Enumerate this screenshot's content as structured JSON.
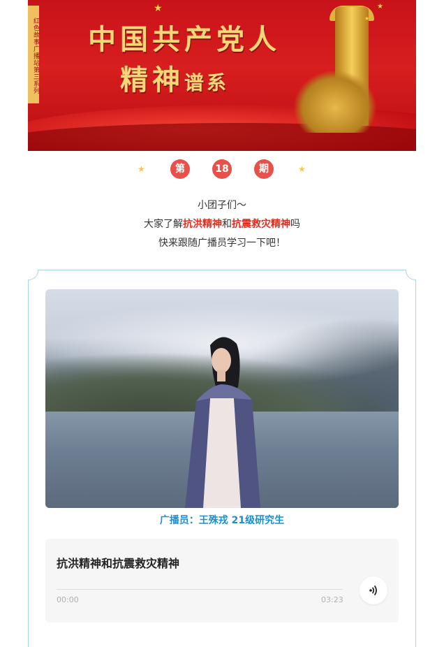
{
  "banner": {
    "side_tag": "红色故事广播站第三系列",
    "title_line1": "中国共产党人",
    "title_line2": "精神",
    "title_line2_small": "谱系"
  },
  "issue": {
    "prefix": "第",
    "number": "18",
    "suffix": "期"
  },
  "intro": {
    "line1": "小团子们～",
    "line2_a": "大家了解",
    "line2_b": "抗洪精神",
    "line2_c": "和",
    "line2_d": "抗震救灾精神",
    "line2_e": "吗",
    "line3": "快来跟随广播员学习一下吧！"
  },
  "caption": "广播员：王殊戎  21级研究生",
  "player": {
    "title": "抗洪精神和抗震救灾精神",
    "time_current": "00:00",
    "time_total": "03:23",
    "progress": 0
  },
  "colors": {
    "accent_red": "#e8504a",
    "highlight_red": "#e32b1c",
    "caption_blue": "#1c8fd0",
    "card_border": "#a6d6e8"
  }
}
